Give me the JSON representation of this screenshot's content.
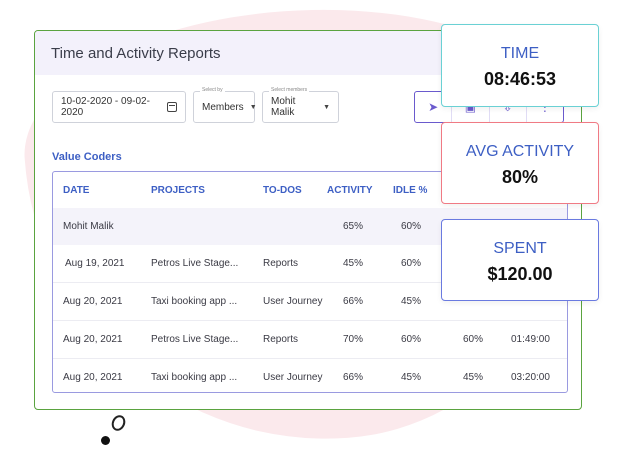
{
  "panel": {
    "title": "Time and Activity Reports",
    "section_label": "Value Coders"
  },
  "filters": {
    "date_range": "10-02-2020 - 09-02-2020",
    "select_by_label": "Select by",
    "select_by_value": "Members",
    "select_members_label": "Select members",
    "select_members_value": "Mohit Malik"
  },
  "actions": [
    "send-icon",
    "check-icon",
    "download-icon",
    "more-icon"
  ],
  "table": {
    "headers": {
      "date": "DATE",
      "projects": "PROJECTS",
      "todos": "TO-DOS",
      "activity": "ACTIVITY",
      "idle": "IDLE %"
    },
    "group": {
      "name": "Mohit Malik",
      "activity": "65%",
      "idle": "60%"
    },
    "rows": [
      {
        "date": "Aug 19, 2021",
        "project": "Petros Live Stage...",
        "todo": "Reports",
        "activity": "45%",
        "idle": "60%",
        "extra": "",
        "time": ""
      },
      {
        "date": "Aug 20, 2021",
        "project": "Taxi booking app ...",
        "todo": "User Journey",
        "activity": "66%",
        "idle": "45%",
        "extra": "",
        "time": ""
      },
      {
        "date": "Aug 20, 2021",
        "project": "Petros Live Stage...",
        "todo": "Reports",
        "activity": "70%",
        "idle": "60%",
        "extra": "60%",
        "time": "01:49:00"
      },
      {
        "date": "Aug 20, 2021",
        "project": "Taxi booking app ...",
        "todo": "User Journey",
        "activity": "66%",
        "idle": "45%",
        "extra": "45%",
        "time": "03:20:00"
      }
    ]
  },
  "cards": {
    "time": {
      "label": "TIME",
      "value": "08:46:53"
    },
    "avg_activity": {
      "label": "AVG ACTIVITY",
      "value": "80%"
    },
    "spent": {
      "label": "SPENT",
      "value": "$120.00"
    }
  },
  "colors": {
    "accent": "#3d5fc4",
    "panel_border": "#5aa33f",
    "time_border": "#6ad1d4",
    "avg_border": "#f07a84",
    "spent_border": "#6a7ae0"
  }
}
